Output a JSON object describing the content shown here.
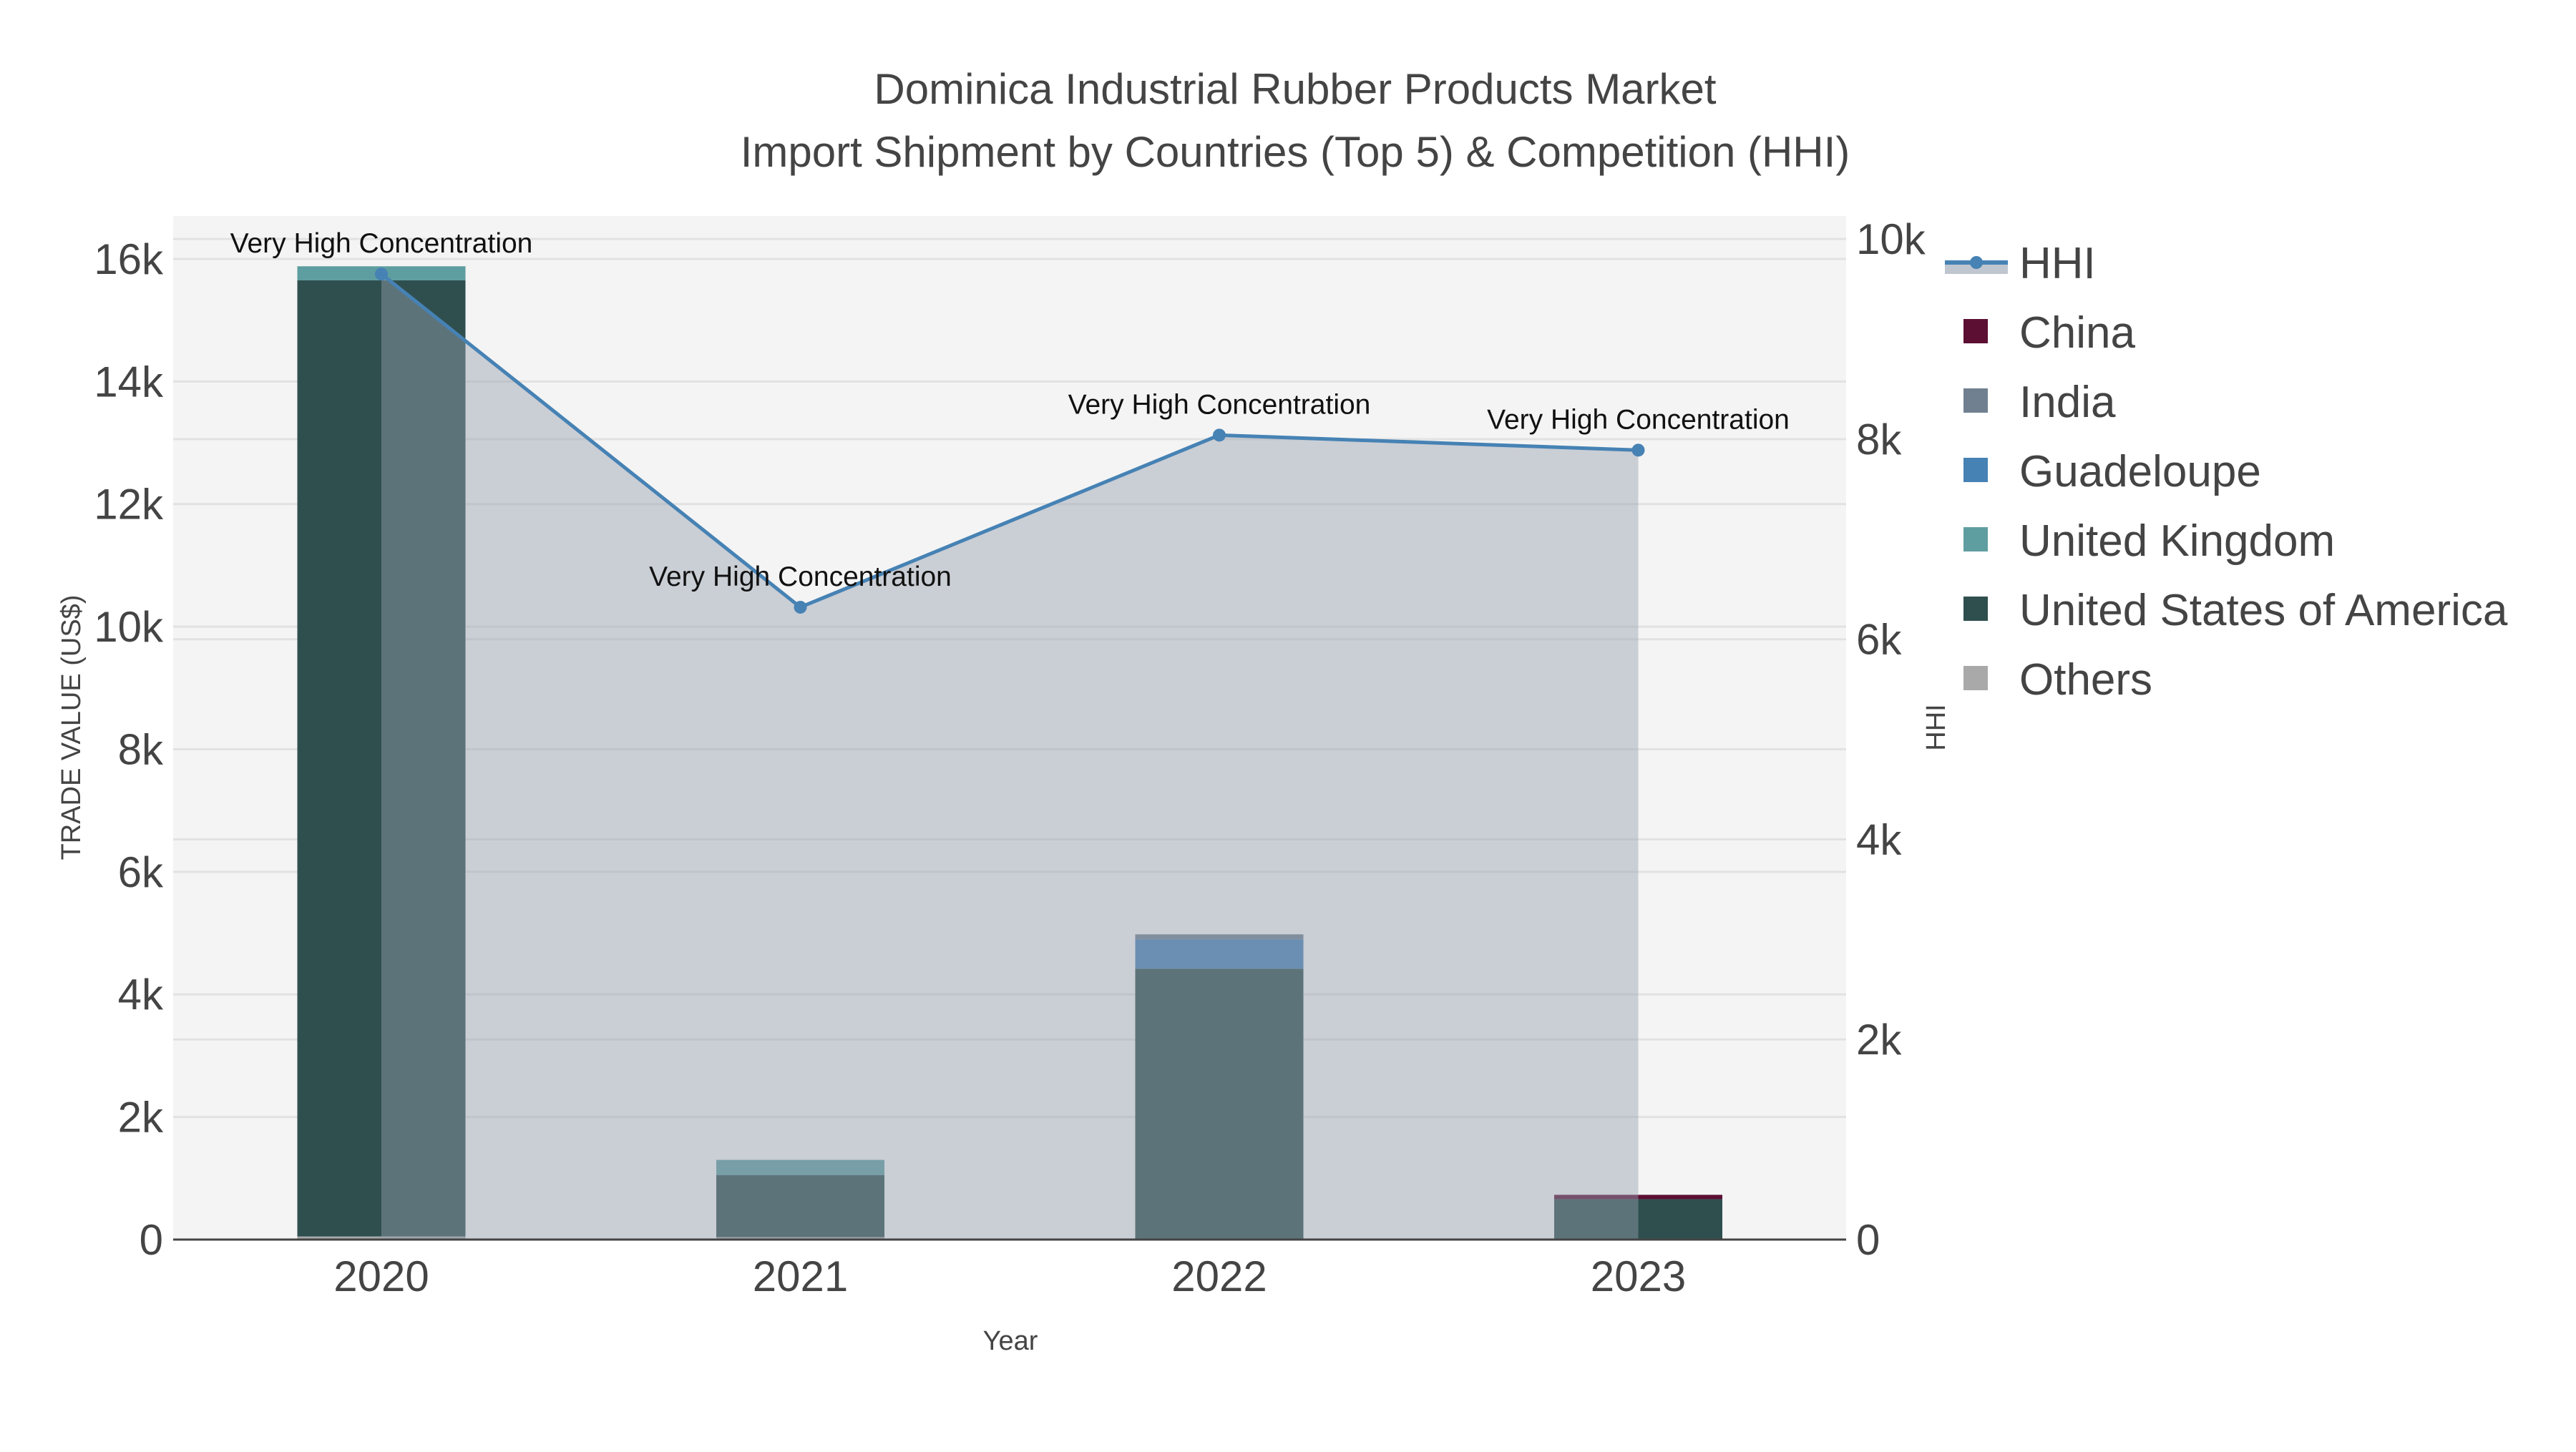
{
  "chart_data": {
    "type": "bar",
    "title": "Dominica Industrial Rubber Products Market",
    "subtitle": "Import Shipment by Countries (Top 5) & Competition (HHI)",
    "xlabel": "Year",
    "ylabel": "TRADE VALUE (US$)",
    "y2label": "HHI",
    "categories": [
      "2020",
      "2021",
      "2022",
      "2023"
    ],
    "ylim": [
      0,
      16700
    ],
    "y2lim": [
      0,
      10230
    ],
    "yticks": [
      {
        "v": 0,
        "label": "0"
      },
      {
        "v": 2000,
        "label": "2k"
      },
      {
        "v": 4000,
        "label": "4k"
      },
      {
        "v": 6000,
        "label": "6k"
      },
      {
        "v": 8000,
        "label": "8k"
      },
      {
        "v": 10000,
        "label": "10k"
      },
      {
        "v": 12000,
        "label": "12k"
      },
      {
        "v": 14000,
        "label": "14k"
      },
      {
        "v": 16000,
        "label": "16k"
      }
    ],
    "y2ticks": [
      {
        "v": 0,
        "label": "0"
      },
      {
        "v": 2000,
        "label": "2k"
      },
      {
        "v": 4000,
        "label": "4k"
      },
      {
        "v": 6000,
        "label": "6k"
      },
      {
        "v": 8000,
        "label": "8k"
      },
      {
        "v": 10000,
        "label": "10k"
      }
    ],
    "grid": true,
    "legend_position": "right",
    "series": [
      {
        "name": "Others",
        "color": "#a9a9a9",
        "values": [
          50,
          40,
          0,
          0
        ]
      },
      {
        "name": "United States of America",
        "color": "#2f4f4f",
        "values": [
          15600,
          1010,
          4420,
          660
        ]
      },
      {
        "name": "United Kingdom",
        "color": "#5f9ea0",
        "values": [
          230,
          250,
          0,
          0
        ]
      },
      {
        "name": "Guadeloupe",
        "color": "#4682b4",
        "values": [
          0,
          0,
          480,
          0
        ]
      },
      {
        "name": "India",
        "color": "#708090",
        "values": [
          0,
          0,
          80,
          0
        ]
      },
      {
        "name": "China",
        "color": "#5c0f33",
        "values": [
          0,
          0,
          0,
          70
        ]
      }
    ],
    "hhi": {
      "name": "HHI",
      "color": "#4682b4",
      "values": [
        9650,
        6320,
        8040,
        7890
      ],
      "annotations": [
        "Very High Concentration",
        "Very High Concentration",
        "Very High Concentration",
        "Very High Concentration"
      ]
    },
    "legend": [
      "HHI",
      "China",
      "India",
      "Guadeloupe",
      "United Kingdom",
      "United States of America",
      "Others"
    ]
  }
}
